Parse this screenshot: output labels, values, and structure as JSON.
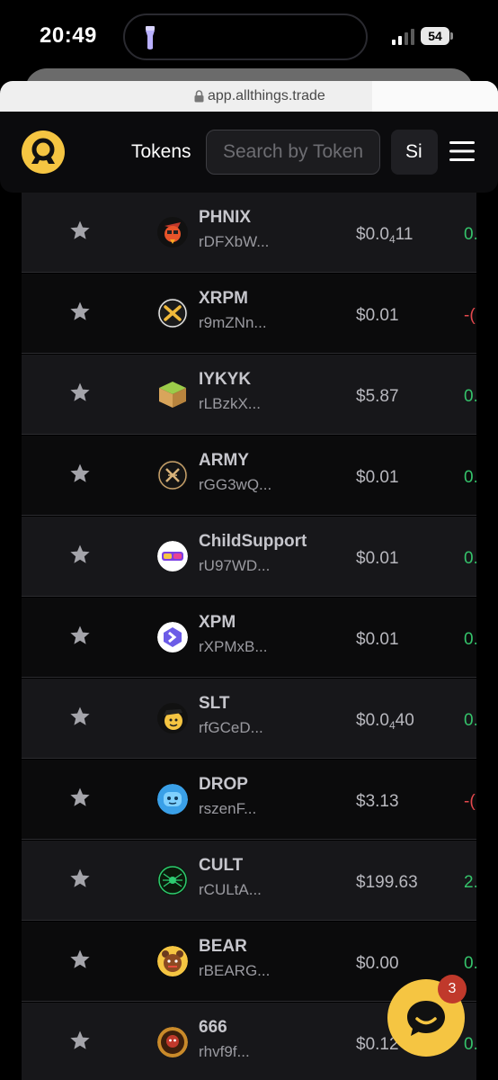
{
  "status_bar": {
    "time": "20:49",
    "battery": "54"
  },
  "browser": {
    "url": "app.allthings.trade"
  },
  "header": {
    "nav_tokens": "Tokens",
    "search_placeholder": "Search by Token",
    "signin_label": "Si",
    "accent_color": "#f5c542"
  },
  "tokens": [
    {
      "name": "PHNIX",
      "address": "rDFXbW...",
      "price_prefix": "$0.0",
      "price_sub": "4",
      "price_suffix": "11",
      "change": "0.",
      "trend": "pos",
      "icon": "phoenix-icon"
    },
    {
      "name": "XRPM",
      "address": "r9mZNn...",
      "price_prefix": "$0.01",
      "price_sub": "",
      "price_suffix": "",
      "change": "-(",
      "trend": "neg",
      "icon": "xrpm-x-icon"
    },
    {
      "name": "IYKYK",
      "address": "rLBzkX...",
      "price_prefix": "$5.87",
      "price_sub": "",
      "price_suffix": "",
      "change": "0.",
      "trend": "pos",
      "icon": "cube-icon"
    },
    {
      "name": "ARMY",
      "address": "rGG3wQ...",
      "price_prefix": "$0.01",
      "price_sub": "",
      "price_suffix": "",
      "change": "0.",
      "trend": "pos",
      "icon": "army-x-icon"
    },
    {
      "name": "ChildSupport",
      "address": "rU97WD...",
      "price_prefix": "$0.01",
      "price_sub": "",
      "price_suffix": "",
      "change": "0.",
      "trend": "pos",
      "icon": "childsupport-icon"
    },
    {
      "name": "XPM",
      "address": "rXPMxB...",
      "price_prefix": "$0.01",
      "price_sub": "",
      "price_suffix": "",
      "change": "0.",
      "trend": "pos",
      "icon": "xpm-icon"
    },
    {
      "name": "SLT",
      "address": "rfGCeD...",
      "price_prefix": "$0.0",
      "price_sub": "4",
      "price_suffix": "40",
      "change": "0.",
      "trend": "pos",
      "icon": "slt-face-icon"
    },
    {
      "name": "DROP",
      "address": "rszenF...",
      "price_prefix": "$3.13",
      "price_sub": "",
      "price_suffix": "",
      "change": "-(",
      "trend": "neg",
      "icon": "drop-face-icon"
    },
    {
      "name": "CULT",
      "address": "rCULtA...",
      "price_prefix": "$199.63",
      "price_sub": "",
      "price_suffix": "",
      "change": "2.",
      "trend": "pos",
      "icon": "cult-spider-icon"
    },
    {
      "name": "BEAR",
      "address": "rBEARG...",
      "price_prefix": "$0.00",
      "price_sub": "",
      "price_suffix": "",
      "change": "0.",
      "trend": "pos",
      "icon": "bear-icon"
    },
    {
      "name": "666",
      "address": "rhvf9f...",
      "price_prefix": "$0.12",
      "price_sub": "",
      "price_suffix": "",
      "change": "0.",
      "trend": "pos",
      "icon": "666-icon"
    }
  ],
  "chat": {
    "badge": "3"
  }
}
